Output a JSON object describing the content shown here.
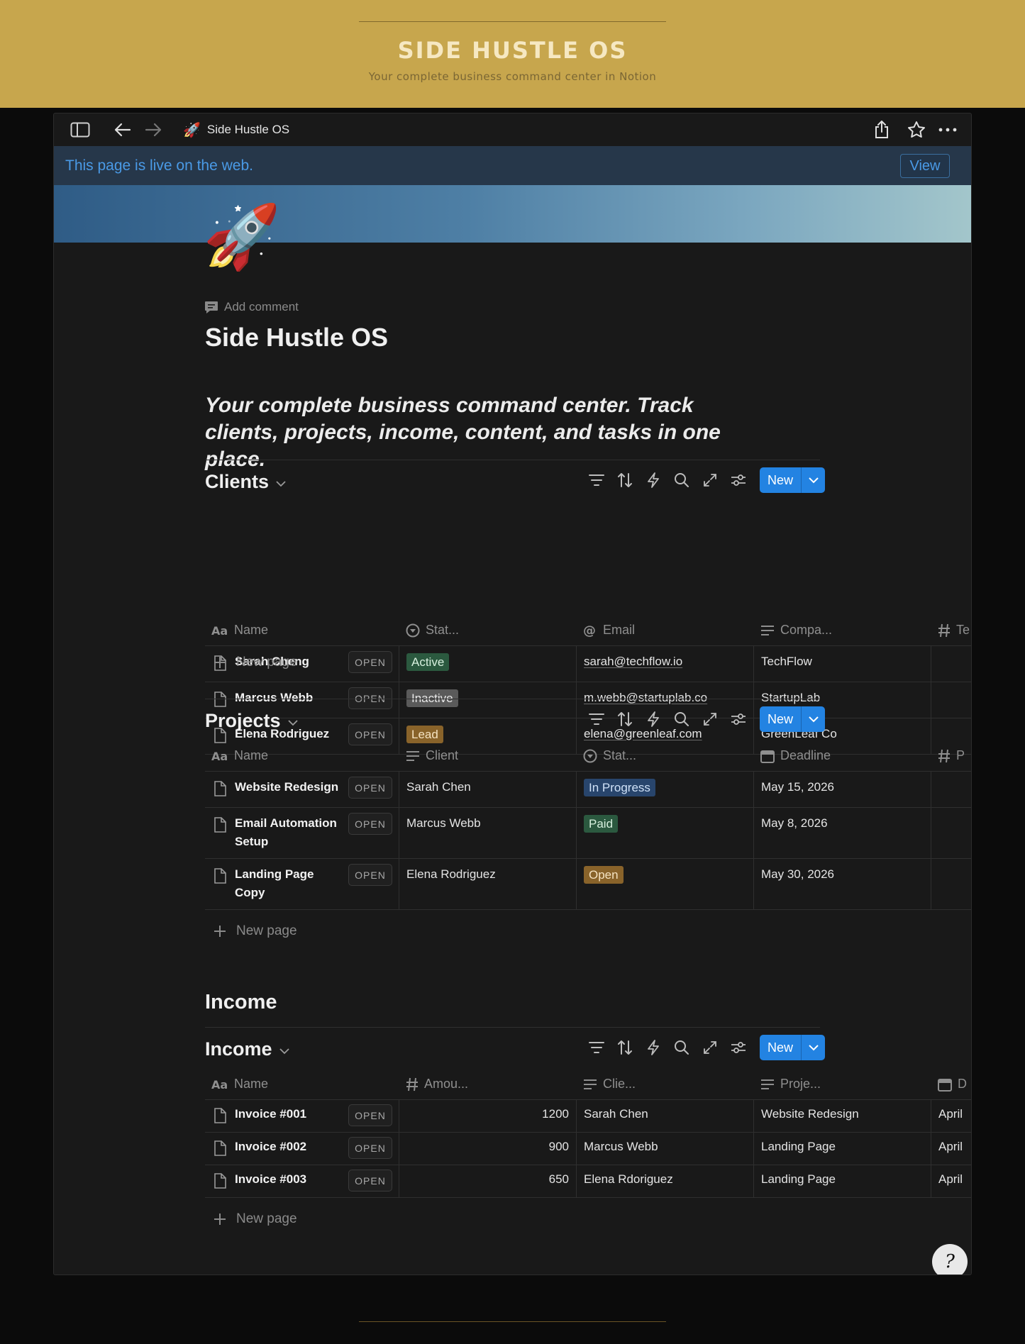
{
  "banner": {
    "title": "SIDE HUSTLE OS",
    "subtitle": "Your complete business command center in Notion"
  },
  "topbar": {
    "breadcrumb_emoji": "🚀",
    "breadcrumb_title": "Side Hustle OS",
    "icons": [
      "sidebar-toggle-icon",
      "back-arrow-icon",
      "forward-arrow-icon",
      "share-icon",
      "star-icon",
      "more-icon"
    ]
  },
  "live_bar": {
    "message": "This page is live on the web.",
    "view_label": "View"
  },
  "page": {
    "icon_emoji": "🚀",
    "add_comment": "Add comment",
    "title": "Side Hustle OS",
    "quote": "Your complete business command center. Track clients, projects, income, content, and tasks in one place."
  },
  "toolbar": {
    "new_label": "New"
  },
  "clients": {
    "title": "Clients",
    "headers": [
      "Name",
      "Stat...",
      "Email",
      "Compa...",
      "Te"
    ],
    "rows": [
      {
        "name": "Sarah Cheng",
        "status": "Active",
        "email": "sarah@techflow.io",
        "company": "TechFlow"
      },
      {
        "name": "Marcus Webb",
        "status": "Inactive",
        "email": "m.webb@startuplab.co",
        "company": "StartupLab"
      },
      {
        "name": "Elena Rodriguez",
        "status": "Lead",
        "email": "elena@greenleaf.com",
        "company": "GreenLeaf Co"
      }
    ],
    "new_page": "New page"
  },
  "projects": {
    "title": "Projects",
    "headers": [
      "Name",
      "Client",
      "Stat...",
      "Deadline",
      "P"
    ],
    "rows": [
      {
        "name": "Website Redesign",
        "client": "Sarah Chen",
        "status": "In Progress",
        "deadline": "May 15, 2026"
      },
      {
        "name": "Email Automation Setup",
        "client": "Marcus Webb",
        "status": "Paid",
        "deadline": "May 8, 2026"
      },
      {
        "name": "Landing Page Copy",
        "client": "Elena Rodriguez",
        "status": "Open",
        "deadline": "May 30, 2026"
      }
    ],
    "new_page": "New page"
  },
  "income_heading": "Income",
  "income": {
    "title": "Income",
    "headers": [
      "Name",
      "Amou...",
      "Clie...",
      "Proje...",
      "D"
    ],
    "rows": [
      {
        "name": "Invoice #001",
        "amount": "1200",
        "client": "Sarah Chen",
        "project": "Website Redesign",
        "date": "April"
      },
      {
        "name": "Invoice #002",
        "amount": "900",
        "client": "Marcus Webb",
        "project": "Landing Page",
        "date": "April"
      },
      {
        "name": "Invoice #003",
        "amount": "650",
        "client": "Elena Rdoriguez",
        "project": "Landing Page",
        "date": "April"
      }
    ],
    "new_page": "New page"
  },
  "open_label": "OPEN",
  "help_glyph": "?",
  "colors": {
    "banner": "#c7a64d",
    "accent_blue": "#2383e2",
    "tag_active": "#2b593f",
    "tag_inactive": "#5a5a5a",
    "tag_lead": "#89632a",
    "tag_in_progress": "#28456c",
    "tag_paid": "#2b593f",
    "tag_open": "#89632a"
  }
}
